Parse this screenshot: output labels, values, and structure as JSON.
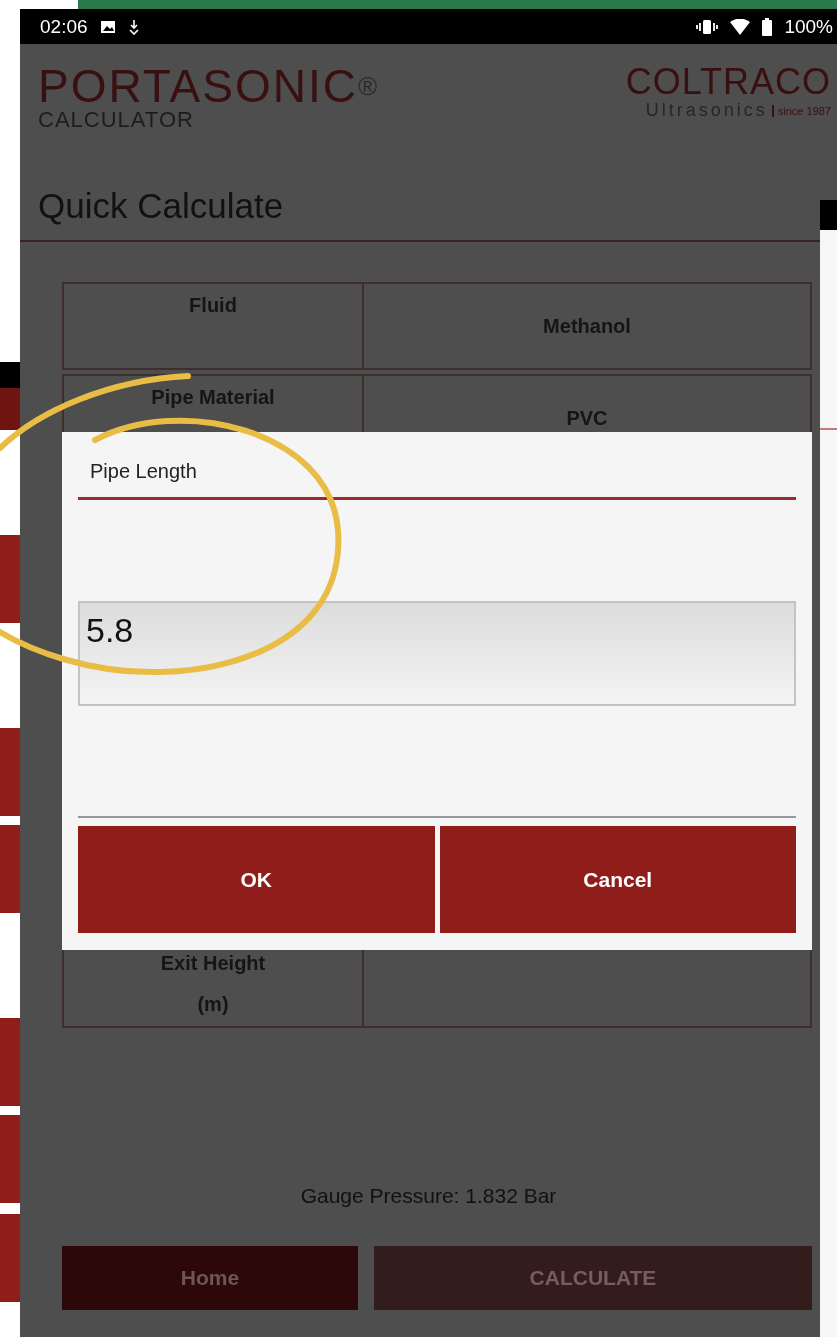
{
  "status_bar": {
    "time": "02:06",
    "battery": "100%"
  },
  "header": {
    "brand": "PORTASONIC",
    "brand_mark": "®",
    "brand_sub": "CALCULATOR",
    "partner": "COLTRACO",
    "partner_sub": "Ultrasonics",
    "partner_since": "since 1987"
  },
  "title": "Quick Calculate",
  "table": {
    "rows": [
      {
        "label": [
          "Fluid"
        ],
        "value": "Methanol"
      },
      {
        "label": [
          "Pipe Material"
        ],
        "value": "PVC"
      },
      {
        "label": [
          "Exit Height",
          "(m)"
        ]
      }
    ]
  },
  "result": "Gauge Pressure: 1.832 Bar",
  "buttons": [
    {
      "label": "Home",
      "disabled": false
    },
    {
      "label": "CALCULATE",
      "disabled": true
    }
  ],
  "dialog": {
    "title": "Pipe Length",
    "value": "5.8",
    "buttons": [
      "OK",
      "Cancel"
    ]
  }
}
